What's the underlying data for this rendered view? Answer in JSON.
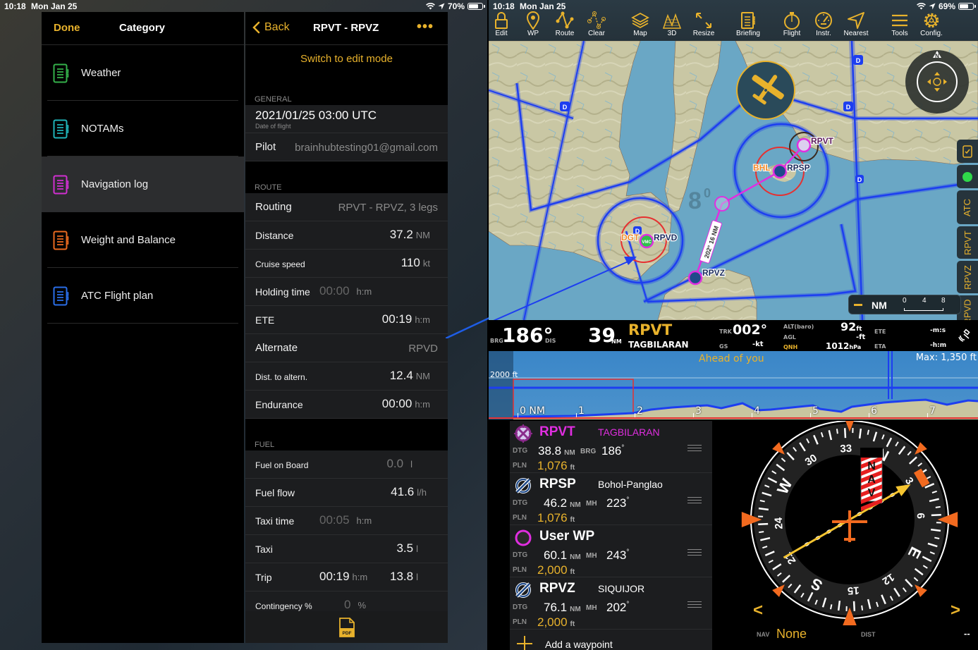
{
  "left_status": {
    "time": "10:18",
    "date": "Mon Jan 25",
    "battery": "70%"
  },
  "right_status": {
    "time": "10:18",
    "date": "Mon Jan 25",
    "battery": "69%"
  },
  "category": {
    "done_label": "Done",
    "title": "Category",
    "items": [
      {
        "label": "Weather",
        "color": "#34b04a"
      },
      {
        "label": "NOTAMs",
        "color": "#1fb3b8"
      },
      {
        "label": "Navigation log",
        "color": "#d12fd0",
        "active": true
      },
      {
        "label": "Weight and Balance",
        "color": "#ea6a1f"
      },
      {
        "label": "ATC Flight plan",
        "color": "#2a6ee8"
      }
    ]
  },
  "navlog": {
    "back_label": "Back",
    "title": "RPVT - RPVZ",
    "more_label": "•••",
    "edit_mode_label": "Switch to edit mode",
    "general": {
      "header": "GENERAL",
      "date": "2021/01/25 03:00 UTC",
      "date_caption": "Date of flight",
      "pilot_label": "Pilot",
      "pilot_value": "brainhubtesting01@gmail.com"
    },
    "route": {
      "header": "ROUTE",
      "routing_label": "Routing",
      "routing_value": "RPVT - RPVZ, 3 legs",
      "distance_label": "Distance",
      "distance_value": "37.2",
      "distance_unit": "NM",
      "cruise_label": "Cruise speed",
      "cruise_value": "110",
      "cruise_unit": "kt",
      "holding_label": "Holding time",
      "holding_value": "00:00",
      "holding_unit": "h:m",
      "ete_label": "ETE",
      "ete_value": "00:19",
      "ete_unit": "h:m",
      "alternate_label": "Alternate",
      "alternate_value": "RPVD",
      "dist_altern_label": "Dist. to altern.",
      "dist_altern_value": "12.4",
      "dist_altern_unit": "NM",
      "endurance_label": "Endurance",
      "endurance_value": "00:00",
      "endurance_unit": "h:m"
    },
    "fuel": {
      "header": "FUEL",
      "fob_label": "Fuel on Board",
      "fob_value": "0.0",
      "fob_unit": "l",
      "flow_label": "Fuel flow",
      "flow_value": "41.6",
      "flow_unit": "l/h",
      "taxi_time_label": "Taxi time",
      "taxi_time_value": "00:05",
      "taxi_time_unit": "h:m",
      "taxi_label": "Taxi",
      "taxi_value": "3.5",
      "taxi_unit": "l",
      "trip_label": "Trip",
      "trip_time": "00:19",
      "trip_time_unit": "h:m",
      "trip_value": "13.8",
      "trip_unit": "l",
      "contingency_label": "Contingency %",
      "contingency_value": "0",
      "contingency_unit": "%"
    },
    "pdf_label": "PDF"
  },
  "toolbar": [
    {
      "label": "Edit",
      "icon": "lock-icon"
    },
    {
      "label": "WP",
      "icon": "pin-icon"
    },
    {
      "label": "Route",
      "icon": "route-icon"
    },
    {
      "label": "Clear",
      "icon": "clear-route-icon"
    },
    {
      "label": "Map",
      "icon": "layers-icon"
    },
    {
      "label": "3D",
      "icon": "terrain-3d-icon"
    },
    {
      "label": "Resize",
      "icon": "resize-icon"
    },
    {
      "label": "Briefing",
      "icon": "briefing-icon"
    },
    {
      "label": "Flight",
      "icon": "stopwatch-icon"
    },
    {
      "label": "Instr.",
      "icon": "gauge-icon"
    },
    {
      "label": "Nearest",
      "icon": "nearest-arrow-icon"
    },
    {
      "label": "Tools",
      "icon": "menu-icon"
    },
    {
      "label": "Config.",
      "icon": "gear-icon"
    }
  ],
  "map": {
    "labels": {
      "rpvt": "RPVT",
      "rpsp": "RPSP",
      "bhl": "BHL",
      "rpvd": "RPVD",
      "dgt": "DGT",
      "rpvz": "RPVZ",
      "vmc": "VMC",
      "leg": "202° 16 NM",
      "mef": "8",
      "mef_sup": "0"
    },
    "side_tabs": [
      "ATC",
      "RPVT",
      "RPVZ",
      "RPVD"
    ],
    "scale": {
      "unit": "NM",
      "ticks": [
        "0",
        "4",
        "8"
      ]
    },
    "compass_n": "N"
  },
  "info_strip": {
    "brg_label": "BRG",
    "brg_value": "186°",
    "dis_label": "DIS",
    "dis_value": "39",
    "dis_unit": "NM",
    "wp_id": "RPVT",
    "wp_name": "TAGBILARAN",
    "trk_label": "TRK",
    "trk_value": "002°",
    "gs_label": "GS",
    "gs_value": "-",
    "gs_unit": "kt",
    "alt_label": "ALT(baro)",
    "alt_value": "92",
    "alt_unit": "ft",
    "agl_label": "AGL",
    "agl_value": "-",
    "agl_unit": "ft",
    "qnh_label": "QNH",
    "qnh_value": "1012",
    "qnh_unit": "hPa",
    "ete_label": "ETE",
    "ete_value": "-",
    "ete_unit": "m:s",
    "eta_label": "ETA",
    "eta_value": "-",
    "eta_unit": "h:m"
  },
  "profile": {
    "title": "Ahead of you",
    "max": "Max: 1,350 ft",
    "alt_label": "2000 ft",
    "distance_ticks": [
      "0 NM",
      "1",
      "2",
      "3",
      "4",
      "5",
      "6",
      "7"
    ]
  },
  "waypoints": [
    {
      "id": "RPVT",
      "name": "TAGBILARAN",
      "dtg": "38.8",
      "dtg_unit": "NM",
      "hdg_label": "BRG",
      "hdg": "186",
      "pln": "1,076",
      "pln_unit": "ft",
      "type": "origin",
      "color": "#e02ee0"
    },
    {
      "id": "RPSP",
      "name": "Bohol-Panglao",
      "dtg": "46.2",
      "dtg_unit": "NM",
      "hdg_label": "MH",
      "hdg": "223",
      "pln": "1,076",
      "pln_unit": "ft",
      "type": "airport",
      "color": "#ffffff"
    },
    {
      "id": "User WP",
      "name": "",
      "dtg": "60.1",
      "dtg_unit": "NM",
      "hdg_label": "MH",
      "hdg": "243",
      "pln": "2,000",
      "pln_unit": "ft",
      "type": "user",
      "color": "#ffffff"
    },
    {
      "id": "RPVZ",
      "name": "SIQUIJOR",
      "dtg": "76.1",
      "dtg_unit": "NM",
      "hdg_label": "MH",
      "hdg": "202",
      "pln": "2,000",
      "pln_unit": "ft",
      "type": "airport",
      "color": "#ffffff"
    }
  ],
  "wp_labels": {
    "dtg": "DTG",
    "pln": "PLN",
    "add": "Add a waypoint"
  },
  "hsi": {
    "flag": "NAV",
    "nav_label": "NAV",
    "nav_value": "None",
    "dist_label": "DIST",
    "dist_value": "--",
    "prev": "<",
    "next": ">",
    "heading_deg": 333,
    "course_deg": 33
  }
}
